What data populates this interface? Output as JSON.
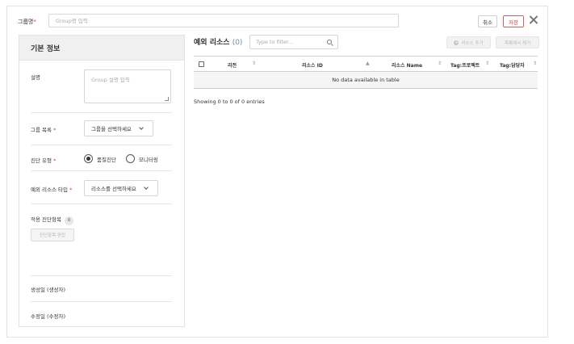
{
  "header": {
    "group_name_label": "그룹명",
    "required_mark": "*",
    "group_name_placeholder": "Group명 입력",
    "cancel_label": "취소",
    "save_label": "저장"
  },
  "basic_info": {
    "title": "기본 정보",
    "description_label": "설명",
    "description_placeholder": "Group 설명 입력",
    "group_list_label": "그룹 목록",
    "group_list_value": "그룹을 선택하세요",
    "diagnosis_type_label": "진단 유형",
    "diagnosis_options": [
      "품질진단",
      "모니터링"
    ],
    "exception_resource_type_label": "예외 리소스 타입",
    "exception_resource_type_value": "리소스를 선택하세요",
    "applied_items_label": "적용 진단항목",
    "applied_items_count": "0",
    "edit_items_label": "진단항목 편집",
    "created_label": "생성일 (생성자)",
    "modified_label": "수정일 (수정자)"
  },
  "exception_resources": {
    "title": "예외 리소스",
    "count": "(0)",
    "filter_placeholder": "Type to filter...",
    "add_label": "리소스 추가",
    "remove_label": "목록에서 제거",
    "columns": [
      "리전",
      "리소스 ID",
      "리소스 Name",
      "Tag:프로젝트",
      "Tag:담당자"
    ],
    "empty_message": "No data available in table",
    "showing_text": "Showing 0 to 0 of 0 entries"
  }
}
